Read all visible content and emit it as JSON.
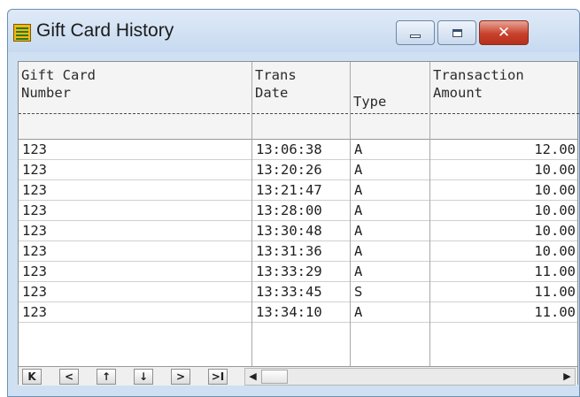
{
  "window": {
    "title": "Gift Card History",
    "icon": "table-grid-icon",
    "controls": [
      "minimize-icon",
      "maximize-icon",
      "close-icon"
    ],
    "close_glyph": "✕"
  },
  "grid": {
    "columns": [
      {
        "line1": "Gift Card",
        "line2": "Number"
      },
      {
        "line1": "Trans",
        "line2": "Date"
      },
      {
        "line1": "",
        "line2": "Type"
      },
      {
        "line1": "Transaction",
        "line2": "Amount"
      }
    ],
    "rows": [
      {
        "number": "123",
        "date": "13:06:38",
        "type": "A",
        "amount": "12.00"
      },
      {
        "number": "123",
        "date": "13:20:26",
        "type": "A",
        "amount": "10.00"
      },
      {
        "number": "123",
        "date": "13:21:47",
        "type": "A",
        "amount": "10.00"
      },
      {
        "number": "123",
        "date": "13:28:00",
        "type": "A",
        "amount": "10.00"
      },
      {
        "number": "123",
        "date": "13:30:48",
        "type": "A",
        "amount": "10.00"
      },
      {
        "number": "123",
        "date": "13:31:36",
        "type": "A",
        "amount": "10.00"
      },
      {
        "number": "123",
        "date": "13:33:29",
        "type": "A",
        "amount": "11.00"
      },
      {
        "number": "123",
        "date": "13:33:45",
        "type": "S",
        "amount": "11.00"
      },
      {
        "number": "123",
        "date": "13:34:10",
        "type": "A",
        "amount": "11.00"
      }
    ]
  },
  "navigation": {
    "buttons": [
      {
        "name": "first-record-button",
        "glyph": "K"
      },
      {
        "name": "previous-page-button",
        "glyph": "<"
      },
      {
        "name": "previous-record-button",
        "glyph": "↑"
      },
      {
        "name": "next-record-button",
        "glyph": "↓"
      },
      {
        "name": "next-page-button",
        "glyph": ">"
      },
      {
        "name": "last-record-button",
        "glyph": ">I"
      }
    ],
    "scroll_left": "◀",
    "scroll_right": "▶"
  }
}
